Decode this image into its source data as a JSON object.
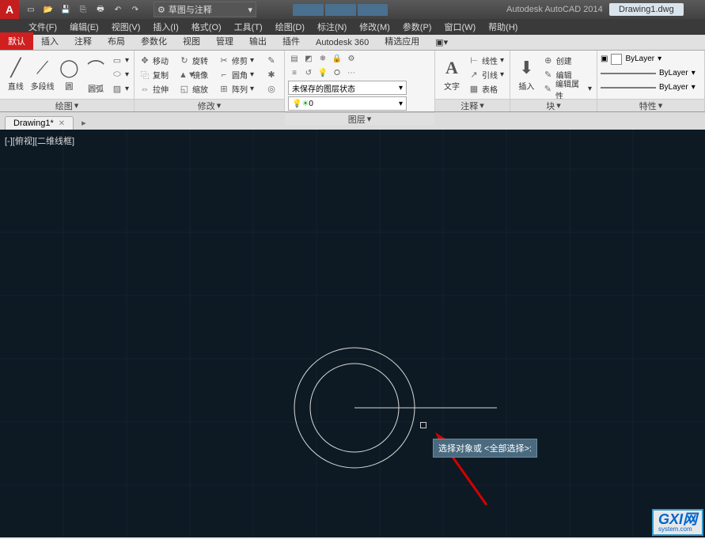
{
  "title": {
    "app": "Autodesk AutoCAD 2014",
    "file": "Drawing1.dwg",
    "workspace": "草图与注释"
  },
  "menus": {
    "items": [
      "文件(F)",
      "编辑(E)",
      "视图(V)",
      "插入(I)",
      "格式(O)",
      "工具(T)",
      "绘图(D)",
      "标注(N)",
      "修改(M)",
      "参数(P)",
      "窗口(W)",
      "帮助(H)"
    ]
  },
  "ribbon_tabs": [
    "默认",
    "插入",
    "注释",
    "布局",
    "参数化",
    "视图",
    "管理",
    "输出",
    "插件",
    "Autodesk 360",
    "精选应用"
  ],
  "ribbon": {
    "draw": {
      "title": "绘图",
      "line": "直线",
      "polyline": "多段线",
      "circle": "圆",
      "arc": "圆弧"
    },
    "modify": {
      "title": "修改",
      "move": "移动",
      "rotate": "旋转",
      "trim": "修剪",
      "copy": "复制",
      "mirror": "镜像",
      "fillet": "圆角",
      "stretch": "拉伸",
      "scale": "缩放",
      "array": "阵列"
    },
    "layer": {
      "title": "图层",
      "unsaved": "未保存的图层状态"
    },
    "annotate": {
      "title": "注释",
      "text": "文字",
      "linear": "线性",
      "leader": "引线",
      "table": "表格"
    },
    "block": {
      "title": "块",
      "insert": "插入",
      "create": "创建",
      "edit": "编辑",
      "attr": "编辑属性"
    },
    "props": {
      "title": "特性",
      "bylayer": "ByLayer"
    }
  },
  "filetab": {
    "name": "Drawing1*"
  },
  "canvas": {
    "view_label": "[-][俯视][二维线框]",
    "tooltip": "选择对象或 <全部选择>:"
  },
  "watermark": {
    "main": "GXI网",
    "sub": "system.com"
  }
}
